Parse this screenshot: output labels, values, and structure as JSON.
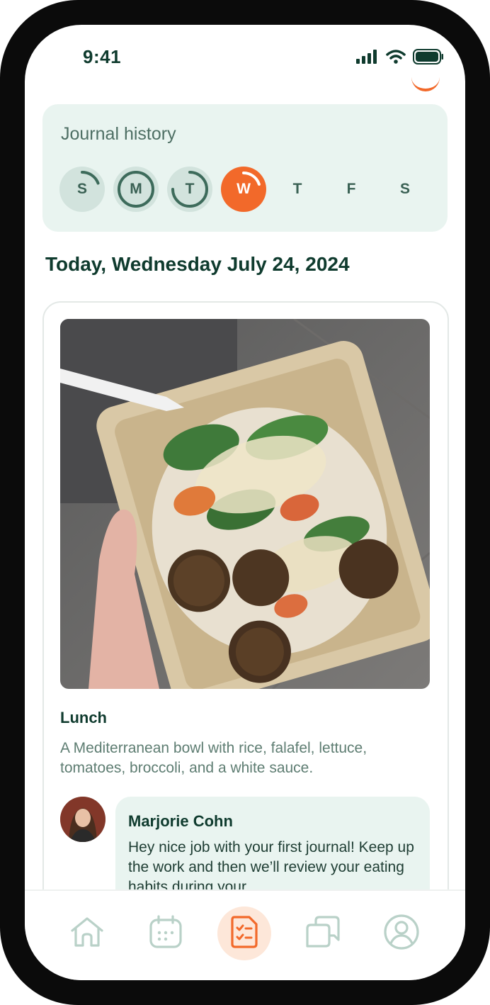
{
  "status_bar": {
    "time": "9:41"
  },
  "journal_history": {
    "title": "Journal history",
    "days": [
      {
        "label": "S",
        "progress": 0.3,
        "state": "past"
      },
      {
        "label": "M",
        "progress": 1.0,
        "state": "past"
      },
      {
        "label": "T",
        "progress": 0.65,
        "state": "past"
      },
      {
        "label": "W",
        "progress": 0.3,
        "state": "today"
      },
      {
        "label": "T",
        "state": "future"
      },
      {
        "label": "F",
        "state": "future"
      },
      {
        "label": "S",
        "state": "future"
      }
    ]
  },
  "date_heading": "Today, Wednesday July 24, 2024",
  "meal": {
    "label": "Lunch",
    "description": "A Mediterranean bowl with rice, falafel, lettuce, tomatoes, broccoli, and a white sauce.",
    "photo": "mediterranean-bowl-photo"
  },
  "comment": {
    "author": "Marjorie Cohn",
    "text": "Hey nice job with your first journal! Keep up the work and then we’ll review your eating habits during your"
  },
  "nav": {
    "items": [
      {
        "name": "home",
        "icon": "home-icon"
      },
      {
        "name": "calendar",
        "icon": "calendar-icon"
      },
      {
        "name": "journal",
        "icon": "checklist-icon",
        "active": true
      },
      {
        "name": "messages",
        "icon": "chat-icon"
      },
      {
        "name": "profile",
        "icon": "user-icon"
      }
    ]
  },
  "colors": {
    "accent": "#f2692a",
    "primary_dark": "#0f3b2e",
    "muted_green": "#3a6154",
    "card_bg": "#e9f4f0"
  }
}
